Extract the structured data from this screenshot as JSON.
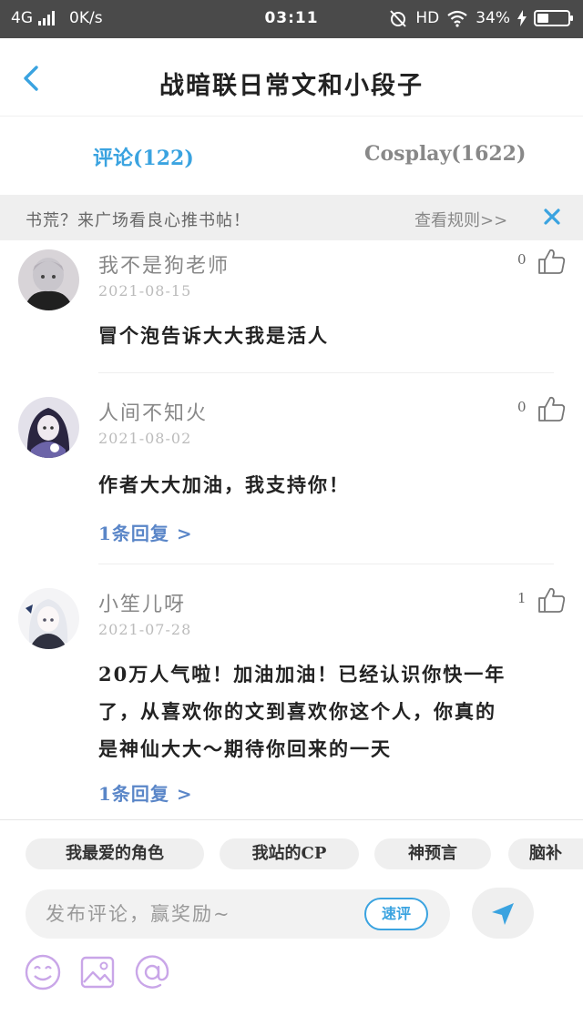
{
  "status_bar": {
    "network": "4G",
    "speed": "0K/s",
    "time": "03:11",
    "hd": "HD",
    "battery": "34%"
  },
  "header": {
    "title": "战暗联日常文和小段子",
    "back_icon": "chevron-left-icon"
  },
  "tabs": [
    {
      "label": "评论(122)",
      "active": true
    },
    {
      "label": "Cosplay(1622)",
      "active": false
    }
  ],
  "notice": {
    "message": "书荒？来广场看良心推书帖！",
    "rules_link": "查看规则>>",
    "close_icon": "close-icon"
  },
  "comments": [
    {
      "username": "我不是狗老师",
      "date": "2021-08-15",
      "content": "冒个泡告诉大大我是活人",
      "likes": "0",
      "reply": ""
    },
    {
      "username": "人间不知火",
      "date": "2021-08-02",
      "content": "作者大大加油，我支持你！",
      "likes": "0",
      "reply": "1条回复 >"
    },
    {
      "username": "小笙儿呀",
      "date": "2021-07-28",
      "content_lines": [
        "20万人气啦！加油加油！已经认识你快一年",
        "了，从喜欢你的文到喜欢你这个人，你真的",
        "是神仙大大～期待你回来的一天"
      ],
      "likes": "1",
      "reply": "1条回复 >"
    }
  ],
  "topics": [
    "我最爱的角色",
    "我站的CP",
    "神预言",
    "脑补"
  ],
  "compose": {
    "placeholder": "发布评论，赢奖励~",
    "quick_label": "速评",
    "send_icon": "send-icon"
  },
  "tools": [
    "emoji-icon",
    "image-icon",
    "mention-icon"
  ],
  "colors": {
    "accent": "#3aa3e0",
    "reply_link": "#5a86c8",
    "tool_icon": "#c9a6e8",
    "status_bar_bg": "#4a4a4a"
  }
}
